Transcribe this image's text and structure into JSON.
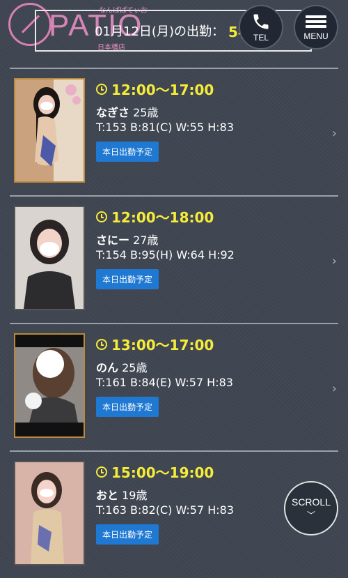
{
  "logo": {
    "text": "PATIO",
    "sub_top": "なんばぱてぃお",
    "sub_bottom": "日本橋店"
  },
  "header": {
    "date_text": "01月12日(月)の出勤：",
    "count": "5名",
    "tel_label": "TEL",
    "menu_label": "MENU"
  },
  "casts": [
    {
      "time": "12:00〜17:00",
      "name": "なぎさ",
      "age": "25歳",
      "stats": "T:153 B:81(C) W:55 H:83",
      "tag": "本日出勤予定"
    },
    {
      "time": "12:00〜18:00",
      "name": "さにー",
      "age": "27歳",
      "stats": "T:154 B:95(H) W:64 H:92",
      "tag": "本日出勤予定"
    },
    {
      "time": "13:00〜17:00",
      "name": "のん",
      "age": "25歳",
      "stats": "T:161 B:84(E) W:57 H:83",
      "tag": "本日出勤予定"
    },
    {
      "time": "15:00〜19:00",
      "name": "おと",
      "age": "19歳",
      "stats": "T:163 B:82(C) W:57 H:83",
      "tag": "本日出勤予定"
    }
  ],
  "scroll_label": "SCROLL",
  "icons": {
    "tel": "phone-icon",
    "menu": "hamburger-icon",
    "clock": "clock-icon",
    "chevron": "chevron-right-icon",
    "scroll": "chevron-down-icon"
  }
}
